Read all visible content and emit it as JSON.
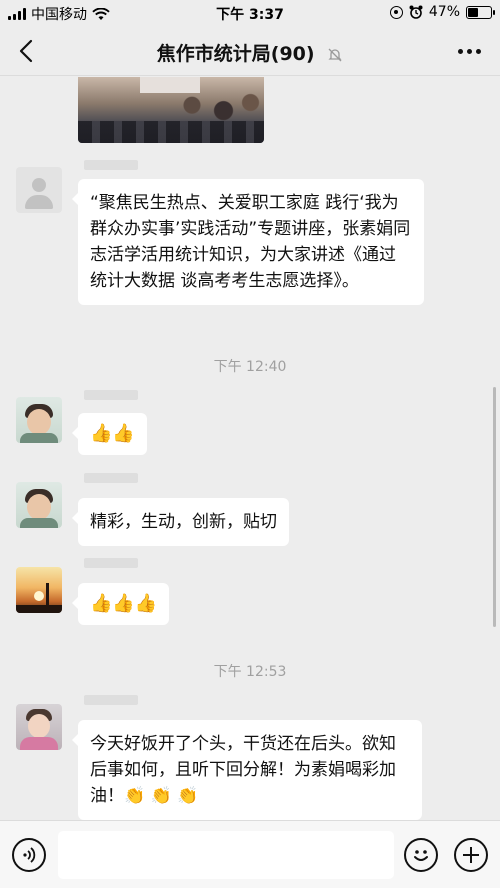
{
  "status_bar": {
    "carrier": "中国移动",
    "time": "下午 3:37",
    "battery": "47%",
    "battery_level": 0.47
  },
  "header": {
    "title": "焦作市统计局(90)",
    "back_icon": "back-arrow-icon",
    "mute_icon": "bell-muted-icon",
    "more_icon": "more-dots-icon"
  },
  "messages": [
    {
      "type": "text",
      "sender": "",
      "avatar": "default-avatar",
      "text": "“聚焦民生热点、关爱职工家庭  践行‘我为群众办实事’实践活动”专题讲座，张素娟同志活学活用统计知识，为大家讲述《通过统计大数据 谈高考考生志愿选择》。"
    },
    {
      "type": "time",
      "text": "下午 12:40"
    },
    {
      "type": "text",
      "sender": "",
      "avatar": "child-avatar",
      "text": "👍👍"
    },
    {
      "type": "text",
      "sender": "",
      "avatar": "child-avatar",
      "text": "精彩，生动，创新，贴切"
    },
    {
      "type": "text",
      "sender": "",
      "avatar": "sunset-avatar",
      "text": "👍👍👍"
    },
    {
      "type": "time",
      "text": "下午 12:53"
    },
    {
      "type": "text",
      "sender": "",
      "avatar": "girl-avatar",
      "text": "今天好饭开了个头，干货还在后头。欲知后事如何，且听下回分解！为素娟喝彩加油！👏 👏 👏"
    }
  ],
  "input_bar": {
    "voice_icon": "voice-icon",
    "emoji_icon": "emoji-icon",
    "plus_icon": "plus-icon",
    "text_value": ""
  }
}
